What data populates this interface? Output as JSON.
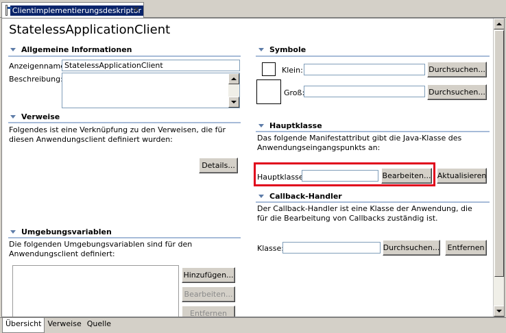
{
  "tab": {
    "title": "Clientimplementierungsdeskriptor",
    "close": "✕"
  },
  "page_title": "StatelessApplicationClient",
  "allgemein": {
    "title": "Allgemeine Informationen",
    "anzeigename_label": "Anzeigenname:",
    "anzeigename_value": "StatelessApplicationClient",
    "beschreibung_label": "Beschreibung:",
    "beschreibung_value": ""
  },
  "verweise": {
    "title": "Verweise",
    "text": "Folgendes ist eine Verknüpfung zu den Verweisen, die für diesen Anwendungsclient definiert wurden:",
    "details_button": "Details..."
  },
  "umgebung": {
    "title": "Umgebungsvariablen",
    "text": "Die folgenden Umgebungsvariablen sind für den Anwendungsclient definiert:",
    "add_button": "Hinzufügen...",
    "edit_button": "Bearbeiten...",
    "remove_button": "Entfernen"
  },
  "symbole": {
    "title": "Symbole",
    "klein_label": "Klein:",
    "klein_value": "",
    "gross_label": "Groß:",
    "gross_value": "",
    "browse_button": "Durchsuchen..."
  },
  "hauptklasse": {
    "title": "Hauptklasse",
    "text": "Das folgende Manifestattribut gibt die Java-Klasse des Anwendungseingangspunkts an:",
    "label": "Hauptklasse:",
    "value": "",
    "edit_button": "Bearbeiten...",
    "refresh_button": "Aktualisieren",
    "highlight_color": "#e0001b"
  },
  "callback": {
    "title": "Callback-Handler",
    "text": "Der Callback-Handler ist eine Klasse der Anwendung, die für die Bearbeitung von Callbacks zuständig ist.",
    "klasse_label": "Klasse:",
    "klasse_value": "",
    "browse_button": "Durchsuchen...",
    "remove_button": "Entfernen"
  },
  "bottom_tabs": [
    "Übersicht",
    "Verweise",
    "Quelle"
  ],
  "colors": {
    "section_separator": "#a6bbd8",
    "section_triangle": "#5d7ca8",
    "selection": "#0a246a"
  }
}
